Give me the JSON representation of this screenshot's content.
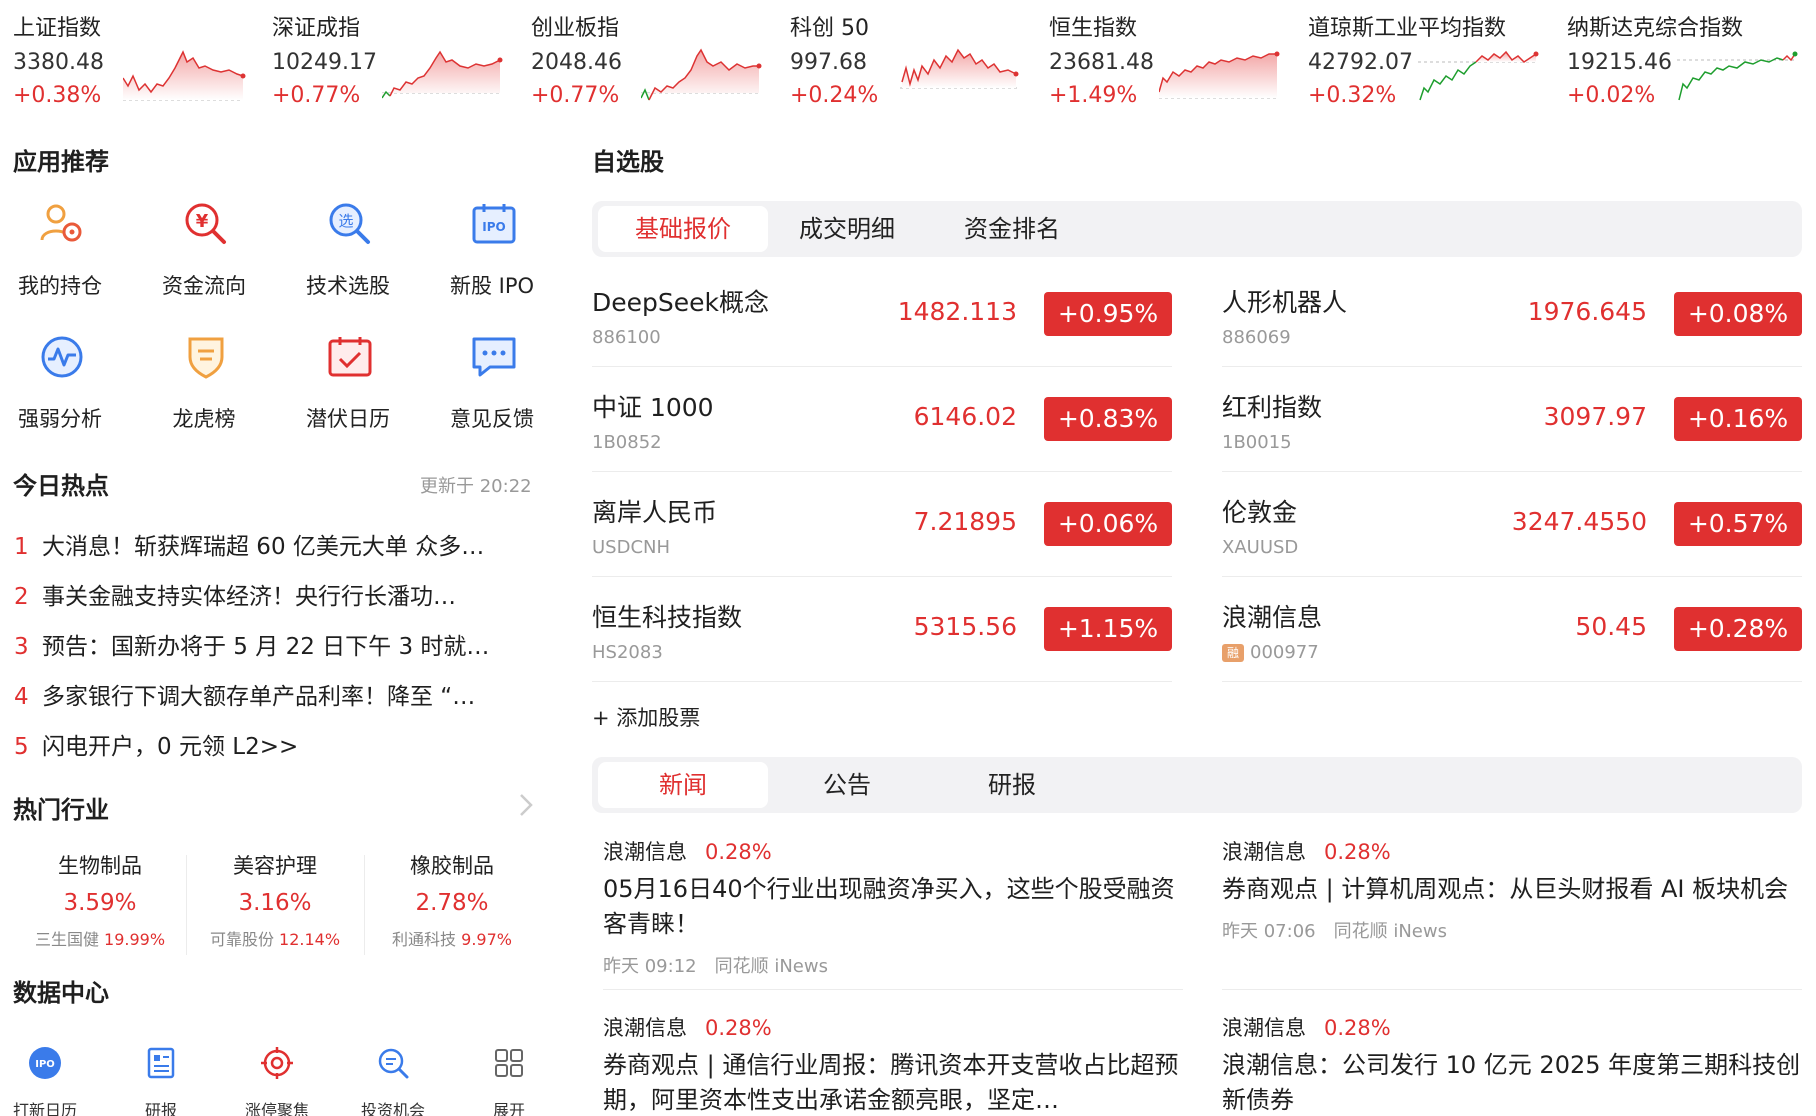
{
  "indices": [
    {
      "name": "上证指数",
      "value": "3380.48",
      "change": "+0.38%"
    },
    {
      "name": "深证成指",
      "value": "10249.17",
      "change": "+0.77%"
    },
    {
      "name": "创业板指",
      "value": "2048.46",
      "change": "+0.77%"
    },
    {
      "name": "科创 50",
      "value": "997.68",
      "change": "+0.24%"
    },
    {
      "name": "恒生指数",
      "value": "23681.48",
      "change": "+1.49%"
    },
    {
      "name": "道琼斯工业平均指数",
      "value": "42792.07",
      "change": "+0.32%"
    },
    {
      "name": "纳斯达克综合指数",
      "value": "19215.46",
      "change": "+0.02%"
    }
  ],
  "apps": {
    "title": "应用推荐",
    "items": [
      {
        "label": "我的持仓",
        "icon": "holdings-icon"
      },
      {
        "label": "资金流向",
        "icon": "money-flow-icon"
      },
      {
        "label": "技术选股",
        "icon": "stock-picker-icon"
      },
      {
        "label": "新股 IPO",
        "icon": "ipo-icon"
      },
      {
        "label": "强弱分析",
        "icon": "strength-analysis-icon"
      },
      {
        "label": "龙虎榜",
        "icon": "dragon-tiger-icon"
      },
      {
        "label": "潜伏日历",
        "icon": "calendar-icon"
      },
      {
        "label": "意见反馈",
        "icon": "feedback-icon"
      }
    ]
  },
  "hot": {
    "title": "今日热点",
    "updated": "更新于 20:22",
    "items": [
      {
        "num": "1",
        "text": "大消息！斩获辉瑞超 60 亿美元大单 众多…"
      },
      {
        "num": "2",
        "text": "事关金融支持实体经济！央行行长潘功…"
      },
      {
        "num": "3",
        "text": "预告：国新办将于 5 月 22 日下午 3 时就…"
      },
      {
        "num": "4",
        "text": "多家银行下调大额存单产品利率！降至 “…"
      },
      {
        "num": "5",
        "text": "闪电开户，0 元领 L2>>"
      }
    ]
  },
  "industries": {
    "title": "热门行业",
    "items": [
      {
        "name": "生物制品",
        "pct": "3.59%",
        "stock": "三生国健",
        "stock_pct": "19.99%"
      },
      {
        "name": "美容护理",
        "pct": "3.16%",
        "stock": "可靠股份",
        "stock_pct": "12.14%"
      },
      {
        "name": "橡胶制品",
        "pct": "2.78%",
        "stock": "利通科技",
        "stock_pct": "9.97%"
      }
    ]
  },
  "datacenter": {
    "title": "数据中心",
    "items": [
      {
        "label": "打新日历"
      },
      {
        "label": "研报"
      },
      {
        "label": "涨停聚焦"
      },
      {
        "label": "投资机会"
      },
      {
        "label": "展开"
      }
    ]
  },
  "watchlist": {
    "title": "自选股",
    "tabs": [
      "基础报价",
      "成交明细",
      "资金排名"
    ],
    "stocks": [
      {
        "name": "DeepSeek概念",
        "code": "886100",
        "price": "1482.113",
        "change": "+0.95%"
      },
      {
        "name": "人形机器人",
        "code": "886069",
        "price": "1976.645",
        "change": "+0.08%"
      },
      {
        "name": "中证 1000",
        "code": "1B0852",
        "price": "6146.02",
        "change": "+0.83%"
      },
      {
        "name": "红利指数",
        "code": "1B0015",
        "price": "3097.97",
        "change": "+0.16%"
      },
      {
        "name": "离岸人民币",
        "code": "USDCNH",
        "price": "7.21895",
        "change": "+0.06%"
      },
      {
        "name": "伦敦金",
        "code": "XAUUSD",
        "price": "3247.4550",
        "change": "+0.57%"
      },
      {
        "name": "恒生科技指数",
        "code": "HS2083",
        "price": "5315.56",
        "change": "+1.15%"
      },
      {
        "name": "浪潮信息",
        "code": "000977",
        "price": "50.45",
        "change": "+0.28%",
        "tag": "融"
      }
    ],
    "add_label": "+ 添加股票"
  },
  "news": {
    "tabs": [
      "新闻",
      "公告",
      "研报"
    ],
    "items": [
      {
        "stock": "浪潮信息",
        "pct": "0.28%",
        "title": "05月16日40个行业出现融资净买入，这些个股受融资客青睐！",
        "time": "昨天 09:12",
        "source": "同花顺 iNews"
      },
      {
        "stock": "浪潮信息",
        "pct": "0.28%",
        "title": "券商观点 | 计算机周观点：从巨头财报看 AI 板块机会",
        "time": "昨天 07:06",
        "source": "同花顺 iNews"
      },
      {
        "stock": "浪潮信息",
        "pct": "0.28%",
        "title": "券商观点 | 通信行业周报：腾讯资本开支营收占比超预期，阿里资本性支出承诺金额亮眼，坚定…",
        "time": "",
        "source": ""
      },
      {
        "stock": "浪潮信息",
        "pct": "0.28%",
        "title": "浪潮信息：公司发行 10 亿元 2025 年度第三期科技创新债券",
        "time": "",
        "source": ""
      }
    ]
  }
}
